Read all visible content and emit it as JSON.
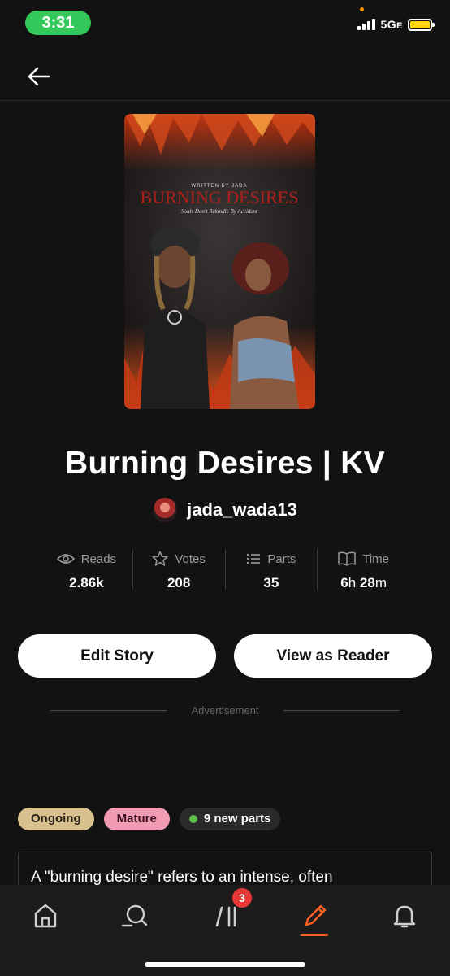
{
  "status_bar": {
    "time": "3:31",
    "network": "5G",
    "network_suffix": "E",
    "battery_color": "#ffd60a"
  },
  "header": {
    "back_icon": "arrow-left-icon"
  },
  "cover": {
    "written_by": "WRITTEN BY JADA",
    "title": "BURNING DESIRES",
    "tagline": "Souls Don't Rekindle By Accident"
  },
  "story": {
    "title": "Burning Desires | KV",
    "author": "jada_wada13"
  },
  "stats": {
    "reads": {
      "label": "Reads",
      "value": "2.86k",
      "icon": "eye-icon"
    },
    "votes": {
      "label": "Votes",
      "value": "208",
      "icon": "star-icon"
    },
    "parts": {
      "label": "Parts",
      "value": "35",
      "icon": "list-icon"
    },
    "time": {
      "label": "Time",
      "hours": "6",
      "hours_unit": "h",
      "minutes": "28",
      "minutes_unit": "m",
      "icon": "book-icon"
    }
  },
  "actions": {
    "edit": "Edit Story",
    "view": "View as Reader"
  },
  "advertisement": "Advertisement",
  "tags": {
    "ongoing": "Ongoing",
    "mature": "Mature",
    "new_parts": "9 new parts"
  },
  "description": "A \"burning desire\" refers to an intense, often",
  "nav": {
    "library_badge": "3",
    "active": "write",
    "accent": "#ff6122"
  }
}
